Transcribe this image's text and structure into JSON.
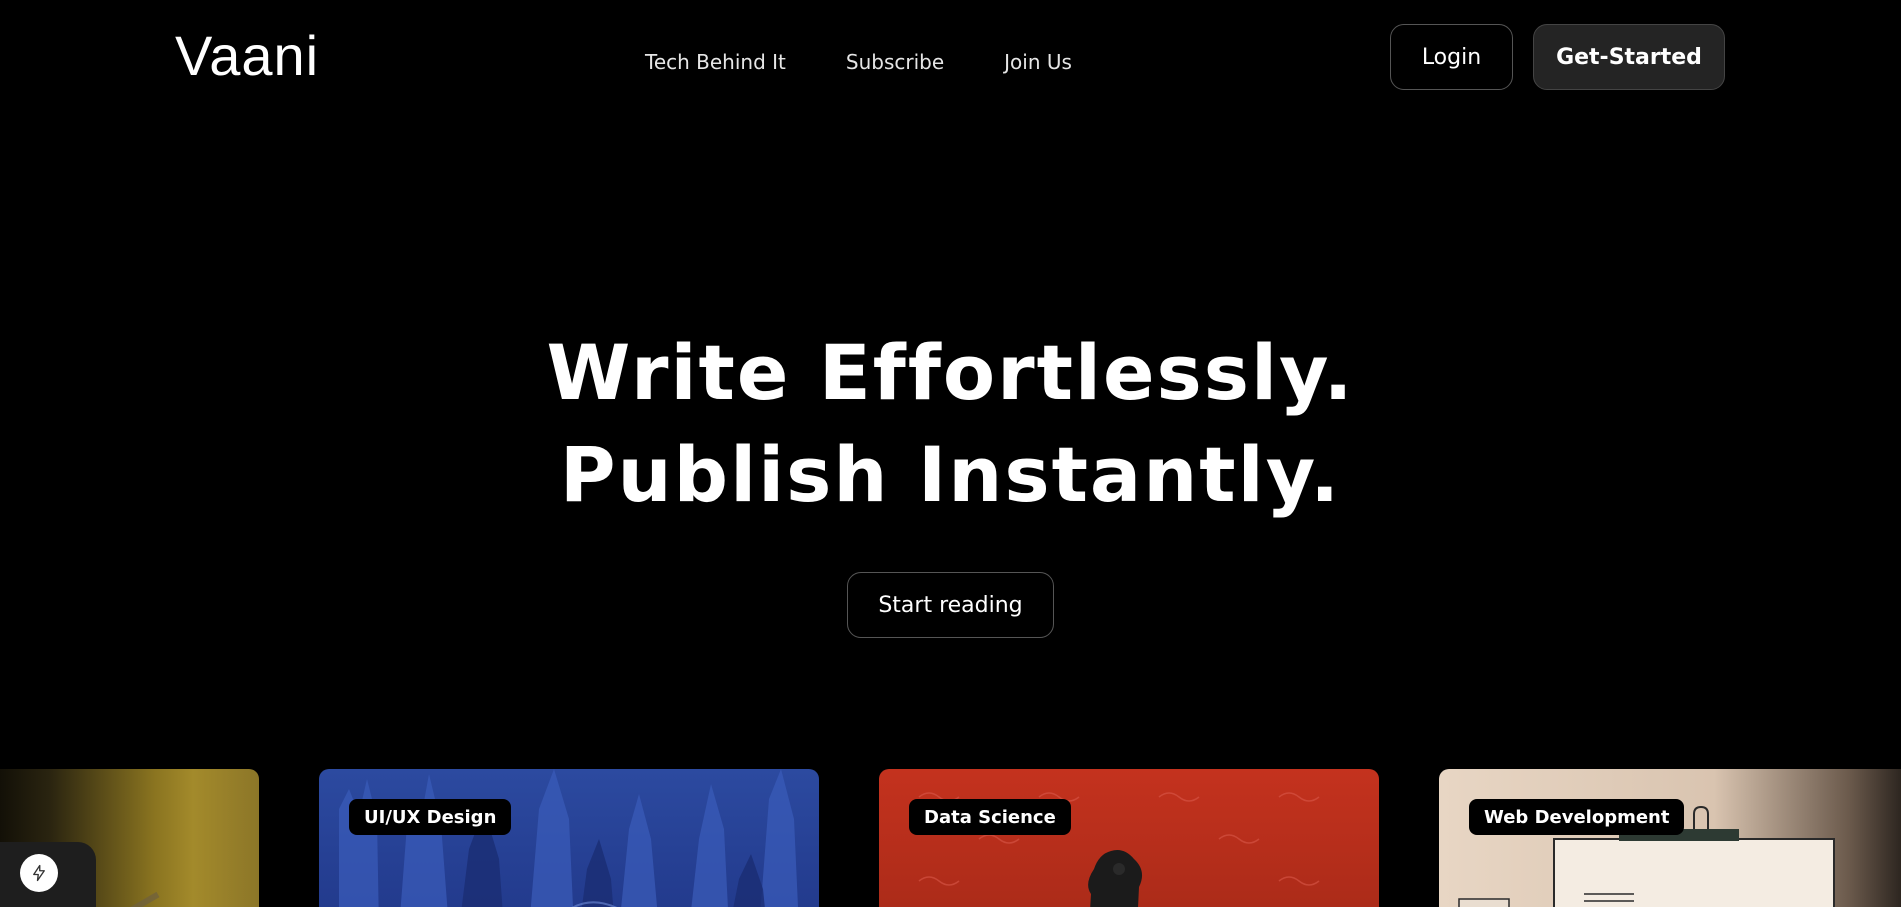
{
  "header": {
    "logo": "Vaani",
    "nav": [
      "Tech Behind It",
      "Subscribe",
      "Join Us"
    ],
    "login_label": "Login",
    "get_started_label": "Get-Started"
  },
  "hero": {
    "title_line1": "Write Effortlessly.",
    "title_line2": "Publish Instantly.",
    "cta_label": "Start reading"
  },
  "cards": [
    {
      "tag": "UI/UX Design",
      "color": "#2c4aa0"
    },
    {
      "tag": "Data Science",
      "color": "#c4321e"
    },
    {
      "tag": "Web Development",
      "color": "#e8d6c4"
    }
  ],
  "floating_button_icon": "bolt-icon",
  "colors": {
    "background": "#000000",
    "text": "#ffffff",
    "primary_button": "#242424",
    "accent_gold": "#a38a2b"
  }
}
